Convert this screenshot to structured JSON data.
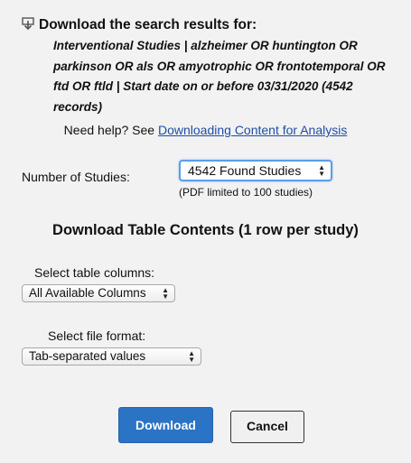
{
  "heading": "Download the search results for:",
  "query_lines": [
    "Interventional Studies | alzheimer OR huntington OR",
    "parkinson OR als OR amyotrophic OR frontotemporal OR",
    "ftd OR ftld | Start date on or before 03/31/2020 (4542",
    "records)"
  ],
  "help": {
    "prefix": "Need help? See ",
    "link_text": "Downloading Content for Analysis"
  },
  "studies": {
    "label": "Number of Studies:",
    "selected": "4542 Found Studies",
    "note": "(PDF limited to 100 studies)"
  },
  "table_section": {
    "title": "Download Table Contents (1 row per study)",
    "columns_label": "Select table columns:",
    "columns_selected": "All Available Columns",
    "format_label": "Select file format:",
    "format_selected": "Tab-separated values"
  },
  "buttons": {
    "download": "Download",
    "cancel": "Cancel"
  },
  "colors": {
    "link": "#1d4fa4",
    "primary_button": "#2b73c4",
    "focus_ring": "#5b9de8"
  },
  "icons": {
    "heading_icon": "download-icon",
    "select_arrows": "up-down-arrows-icon"
  }
}
